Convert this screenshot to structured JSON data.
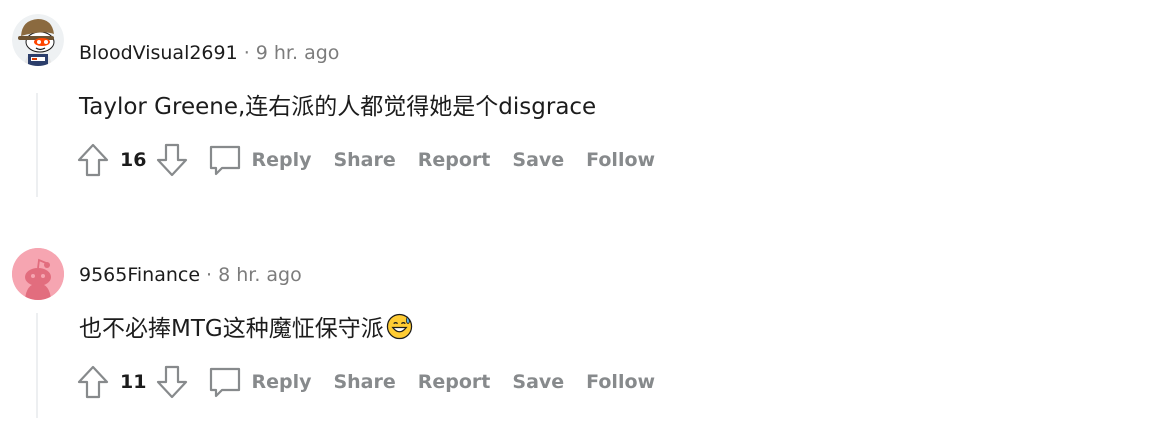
{
  "comments": [
    {
      "username": "BloodVisual2691",
      "separator": "·",
      "time": "9 hr. ago",
      "text": "Taylor Greene,连右派的人都觉得她是个disgrace",
      "score": "16",
      "actions": {
        "reply": "Reply",
        "share": "Share",
        "report": "Report",
        "save": "Save",
        "follow": "Follow"
      }
    },
    {
      "username": "9565Finance",
      "separator": "·",
      "time": "8 hr. ago",
      "text": "也不必捧MTG这种魔怔保守派",
      "emoji": "grinning-sweat-emoji",
      "score": "11",
      "actions": {
        "reply": "Reply",
        "share": "Share",
        "report": "Report",
        "save": "Save",
        "follow": "Follow"
      }
    }
  ],
  "colors": {
    "meta": "#7c7c7c",
    "action": "#878a8c",
    "thread_line": "#edeff1",
    "avatar2_bg": "#f6a5b1"
  }
}
